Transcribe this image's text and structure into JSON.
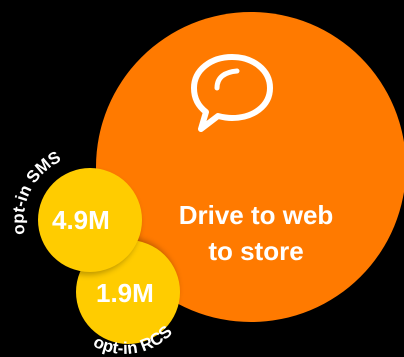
{
  "diagram": {
    "main_label": "Drive to web\nto store",
    "main_icon": "speech-bubble-icon",
    "segments": [
      {
        "label": "opt-in SMS",
        "value": "4.9M"
      },
      {
        "label": "opt-in RCS",
        "value": "1.9M"
      }
    ],
    "colors": {
      "background": "#000000",
      "main_circle": "#FF7A00",
      "small_circles": "#FFCC00",
      "text": "#FFFFFF"
    }
  }
}
